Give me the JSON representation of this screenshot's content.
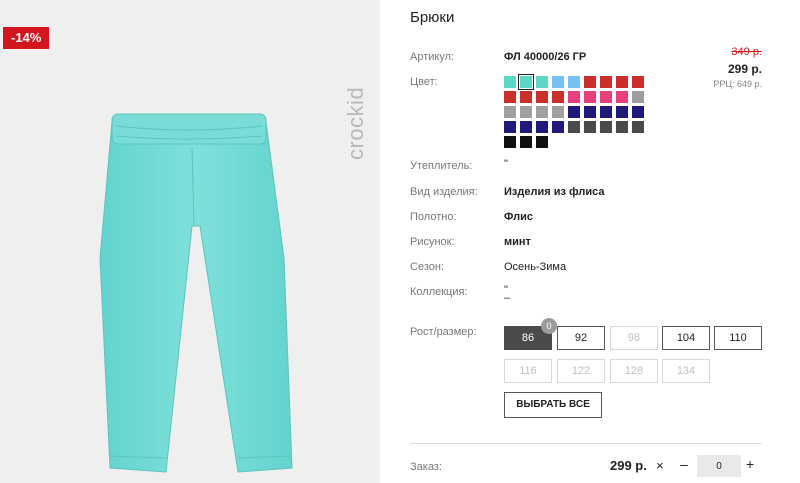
{
  "product": {
    "title": "Брюки",
    "discount_badge": "-14%",
    "brand": "crockid"
  },
  "price": {
    "old": "349 р.",
    "current": "299 р.",
    "rrp": "РРЦ: 649 р."
  },
  "attributes": {
    "article_label": "Артикул:",
    "article_value": "ФЛ 40000/26 ГР",
    "color_label": "Цвет:",
    "insulation_label": "Утеплитель:",
    "insulation_value": "\"",
    "type_label": "Вид изделия:",
    "type_value": "Изделия из флиса",
    "fabric_label": "Полотно:",
    "fabric_value": "Флис",
    "pattern_label": "Рисунок:",
    "pattern_value": "минт",
    "season_label": "Сезон:",
    "season_value": "Осень-Зима",
    "collection_label": "Коллекция:",
    "collection_value_1": "\"",
    "collection_value_2": "–",
    "size_label": "Рост/размер:"
  },
  "colors": [
    "#5ed6c4",
    "#5ed6c4",
    "#5ed6c4",
    "#74c0f0",
    "#74c0f0",
    "#c9302c",
    "#c9302c",
    "#c9302c",
    "#c9302c",
    "#c9302c",
    "#c9302c",
    "#c9302c",
    "#c9302c",
    "#e8407c",
    "#e8407c",
    "#e8407c",
    "#e8407c",
    "#9e9e9e",
    "#a0a0a0",
    "#a0a0a0",
    "#a0a0a0",
    "#a0a0a0",
    "#1f1a7a",
    "#1f1a7a",
    "#1f1a7a",
    "#1f1a7a",
    "#1f1a7a",
    "#1f1a7a",
    "#1f1a7a",
    "#1f1a7a",
    "#1f1a7a",
    "#4a4a4a",
    "#4a4a4a",
    "#4a4a4a",
    "#4a4a4a",
    "#4a4a4a",
    "#111111",
    "#111111",
    "#111111"
  ],
  "selected_color_index": 1,
  "sizes": [
    {
      "label": "86",
      "state": "active"
    },
    {
      "label": "92",
      "state": "enabled"
    },
    {
      "label": "98",
      "state": "disabled"
    },
    {
      "label": "104",
      "state": "enabled"
    },
    {
      "label": "110",
      "state": "enabled"
    },
    {
      "label": "116",
      "state": "disabled"
    },
    {
      "label": "122",
      "state": "disabled"
    },
    {
      "label": "128",
      "state": "disabled"
    },
    {
      "label": "134",
      "state": "disabled"
    }
  ],
  "size_badge": "0",
  "select_all_label": "ВЫБРАТЬ ВСЕ",
  "order": {
    "label": "Заказ:",
    "price": "299 р.",
    "times": "×",
    "minus": "–",
    "quantity": "0",
    "plus": "+"
  },
  "accent_colors": {
    "discount": "#d3161d",
    "pants": "#6fd9d4"
  }
}
